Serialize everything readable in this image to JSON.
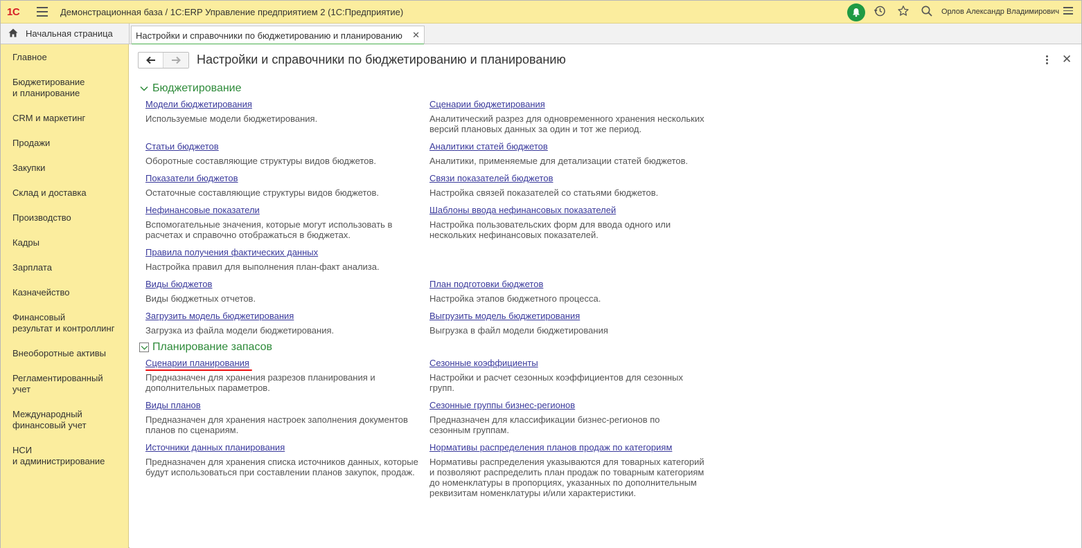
{
  "app": {
    "logo": "1С",
    "title": "Демонстрационная база / 1С:ERP Управление предприятием 2  (1С:Предприятие)",
    "user": "Орлов Александр Владимирович"
  },
  "tabs": {
    "home": "Начальная страница",
    "active": "Настройки и справочники по бюджетированию и планированию"
  },
  "sidebar": {
    "items": [
      "Главное",
      "Бюджетирование\nи планирование",
      "CRM и маркетинг",
      "Продажи",
      "Закупки",
      "Склад и доставка",
      "Производство",
      "Кадры",
      "Зарплата",
      "Казначейство",
      "Финансовый\nрезультат и контроллинг",
      "Внеоборотные активы",
      "Регламентированный\nучет",
      "Международный\nфинансовый учет",
      "НСИ\nи администрирование"
    ]
  },
  "page": {
    "title": "Настройки и справочники по бюджетированию и планированию"
  },
  "sections": [
    {
      "title": "Бюджетирование",
      "items": [
        {
          "link": "Модели бюджетирования",
          "desc": "Используемые модели бюджетирования."
        },
        {
          "link": "Сценарии бюджетирования",
          "desc": "Аналитический разрез для одновременного хранения нескольких версий плановых данных за один и тот же период."
        },
        {
          "link": "Статьи бюджетов",
          "desc": "Оборотные составляющие структуры видов бюджетов."
        },
        {
          "link": "Аналитики статей бюджетов",
          "desc": "Аналитики, применяемые для детализации статей бюджетов."
        },
        {
          "link": "Показатели бюджетов",
          "desc": "Остаточные составляющие структуры видов бюджетов."
        },
        {
          "link": "Связи показателей бюджетов",
          "desc": "Настройка связей показателей со статьями бюджетов."
        },
        {
          "link": "Нефинансовые показатели",
          "desc": "Вспомогательные значения, которые могут использовать в расчетах и справочно отображаться в бюджетах."
        },
        {
          "link": "Шаблоны ввода нефинансовых показателей",
          "desc": "Настройка пользовательских форм для ввода одного или нескольких нефинансовых показателей."
        },
        {
          "link": "Правила получения фактических данных",
          "desc": "Настройка правил для выполнения план-факт анализа."
        },
        {
          "link": "Виды бюджетов",
          "desc": "Виды бюджетных отчетов."
        },
        {
          "link": "План подготовки бюджетов",
          "desc": "Настройка этапов бюджетного процесса."
        },
        {
          "link": "Загрузить модель бюджетирования",
          "desc": "Загрузка из файла модели бюджетирования."
        },
        {
          "link": "Выгрузить модель бюджетирования",
          "desc": "Выгрузка в файл модели бюджетирования"
        }
      ]
    },
    {
      "title": "Планирование запасов",
      "items": [
        {
          "link": "Сценарии планирования",
          "desc": "Предназначен для хранения разрезов планирования и дополнительных параметров."
        },
        {
          "link": "Сезонные коэффициенты",
          "desc": "Настройки и расчет сезонных коэффициентов для сезонных групп."
        },
        {
          "link": "Виды планов",
          "desc": "Предназначен для хранения настроек заполнения документов планов по сценариям."
        },
        {
          "link": "Сезонные группы бизнес-регионов",
          "desc": "Предназначен для классификации бизнес-регионов по сезонным группам."
        },
        {
          "link": "Источники данных планирования",
          "desc": "Предназначен для хранения списка источников данных, которые будут использоваться при составлении планов закупок, продаж."
        },
        {
          "link": "Нормативы распределения планов продаж по категориям",
          "desc": "Нормативы распределения указываются для товарных категорий и позволяют распределить план продаж по товарным категориям до номенклатуры в пропорциях, указанных по дополнительным реквизитам номенклатуры и/или характеристики."
        }
      ]
    }
  ],
  "colors": {
    "header_bg": "#fbed9e",
    "section_green": "#2e8b3a",
    "link_blue": "#3a3a9c",
    "highlight_red": "#e11111",
    "bell_green": "#1f9a44"
  }
}
